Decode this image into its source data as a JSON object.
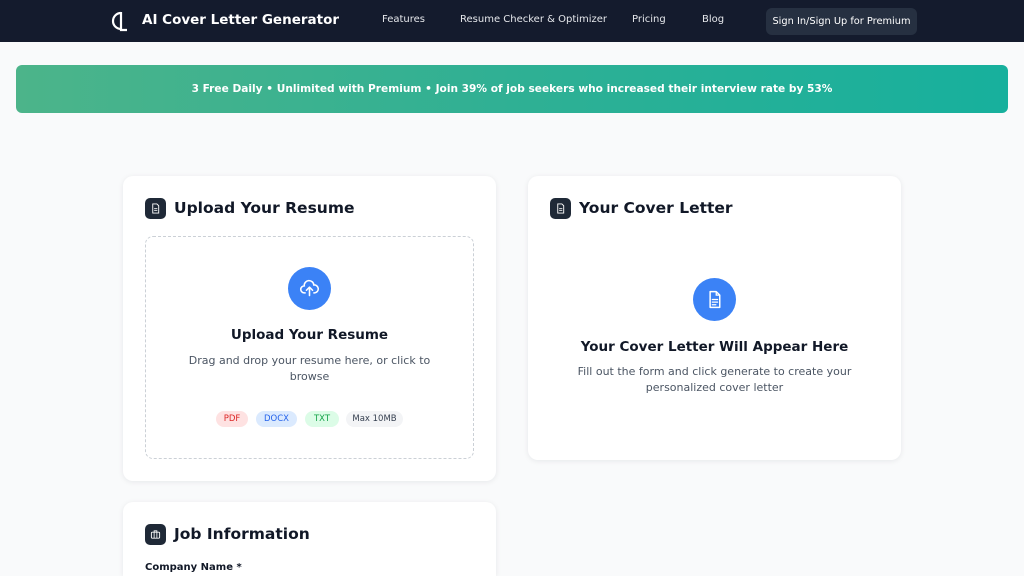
{
  "header": {
    "brand": "AI Cover Letter Generator",
    "nav": [
      "Features",
      "Resume Checker & Optimizer",
      "Pricing",
      "Blog"
    ],
    "signin_label": "Sign In/Sign Up for Premium"
  },
  "banner": {
    "text": "3 Free Daily • Unlimited with Premium • Join 39% of job seekers who increased their interview rate by 53%"
  },
  "upload_card": {
    "title": "Upload Your Resume",
    "dropzone_title": "Upload Your Resume",
    "dropzone_desc_line1": "Drag and drop your resume here, or click to",
    "dropzone_desc_line2": "browse",
    "formats": [
      "PDF",
      "DOCX",
      "TXT"
    ],
    "max_size": "Max 10MB"
  },
  "cover_card": {
    "title": "Your Cover Letter",
    "empty_title": "Your Cover Letter Will Appear Here",
    "empty_desc_line1": "Fill out the form and click generate to create your",
    "empty_desc_line2": "personalized cover letter"
  },
  "job_card": {
    "title": "Job Information",
    "company_label": "Company Name *"
  },
  "colors": {
    "header_bg": "#141b2d",
    "banner_start": "#4cb48a",
    "banner_end": "#17b09d",
    "accent_blue": "#3b82f6",
    "pdf_chip_bg": "#fee2e2",
    "pdf_chip_text": "#dc2626",
    "docx_chip_bg": "#dbeafe",
    "docx_chip_text": "#2563eb",
    "txt_chip_bg": "#dcfce7",
    "txt_chip_text": "#16a34a"
  },
  "icons": {
    "logo": "cl-logo-icon",
    "upload": "cloud-upload-icon",
    "document": "document-icon",
    "briefcase": "briefcase-icon"
  }
}
